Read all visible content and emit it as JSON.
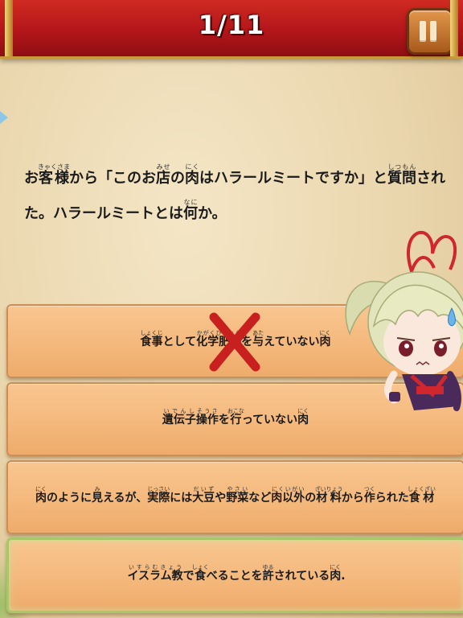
{
  "header": {
    "progress_label": "1/11"
  },
  "question": {
    "segments": [
      {
        "text": "お",
        "ruby": null
      },
      {
        "text": "客様",
        "ruby": "きゃくさま"
      },
      {
        "text": "から「このお",
        "ruby": null
      },
      {
        "text": "店",
        "ruby": "みせ"
      },
      {
        "text": "の",
        "ruby": null
      },
      {
        "text": "肉",
        "ruby": "にく"
      },
      {
        "text": "はハラールミートですか」と",
        "ruby": null
      },
      {
        "text": "質問",
        "ruby": "しつもん"
      },
      {
        "text": "された。ハラールミートとは",
        "ruby": null
      },
      {
        "text": "何",
        "ruby": "なに"
      },
      {
        "text": "か。",
        "ruby": null
      }
    ]
  },
  "answers": [
    {
      "state": "wrong",
      "segments": [
        {
          "text": "食事",
          "ruby": "しょくじ"
        },
        {
          "text": "として",
          "ruby": null
        },
        {
          "text": "化学肥料",
          "ruby": "かがくひりょう"
        },
        {
          "text": "を",
          "ruby": null
        },
        {
          "text": "与",
          "ruby": "あた"
        },
        {
          "text": "えていない",
          "ruby": null
        },
        {
          "text": "肉",
          "ruby": "にく"
        }
      ]
    },
    {
      "state": "default",
      "segments": [
        {
          "text": "遺伝子",
          "ruby": "いでんし"
        },
        {
          "text": "操作",
          "ruby": "そうさ"
        },
        {
          "text": "を",
          "ruby": null
        },
        {
          "text": "行",
          "ruby": "おこな"
        },
        {
          "text": "っていない",
          "ruby": null
        },
        {
          "text": "肉",
          "ruby": "にく"
        }
      ]
    },
    {
      "state": "default",
      "segments": [
        {
          "text": "肉",
          "ruby": "にく"
        },
        {
          "text": "のように",
          "ruby": null
        },
        {
          "text": "見",
          "ruby": "み"
        },
        {
          "text": "えるが、",
          "ruby": null
        },
        {
          "text": "実際",
          "ruby": "じっさい"
        },
        {
          "text": "には",
          "ruby": null
        },
        {
          "text": "大豆",
          "ruby": "だいず"
        },
        {
          "text": "や",
          "ruby": null
        },
        {
          "text": "野菜",
          "ruby": "やさい"
        },
        {
          "text": "など",
          "ruby": null
        },
        {
          "text": "肉以外",
          "ruby": "にくいがい"
        },
        {
          "text": "の",
          "ruby": null
        },
        {
          "text": "材料",
          "ruby": "ざいりょう"
        },
        {
          "text": "から",
          "ruby": null
        },
        {
          "text": "作",
          "ruby": "つく"
        },
        {
          "text": "られた",
          "ruby": null
        },
        {
          "text": "食材",
          "ruby": "しょくざい"
        }
      ]
    },
    {
      "state": "highlighted",
      "segments": [
        {
          "text": "イスラム教",
          "ruby": "いすらむきょう"
        },
        {
          "text": "で",
          "ruby": null
        },
        {
          "text": "食",
          "ruby": "しょく"
        },
        {
          "text": "べることを",
          "ruby": null
        },
        {
          "text": "許",
          "ruby": "ゆる"
        },
        {
          "text": "されている",
          "ruby": null
        },
        {
          "text": "肉",
          "ruby": "にく"
        },
        {
          "text": ".",
          "ruby": null
        }
      ]
    }
  ],
  "icons": {
    "pause": "pause-icon",
    "wrong": "cross-mark-icon",
    "mascot": "mascot-character"
  },
  "colors": {
    "banner": "#b3161a",
    "answer_bg": "#f4b77a",
    "wrong_mark": "#c8201e",
    "highlight_border": "#a8c76a"
  }
}
